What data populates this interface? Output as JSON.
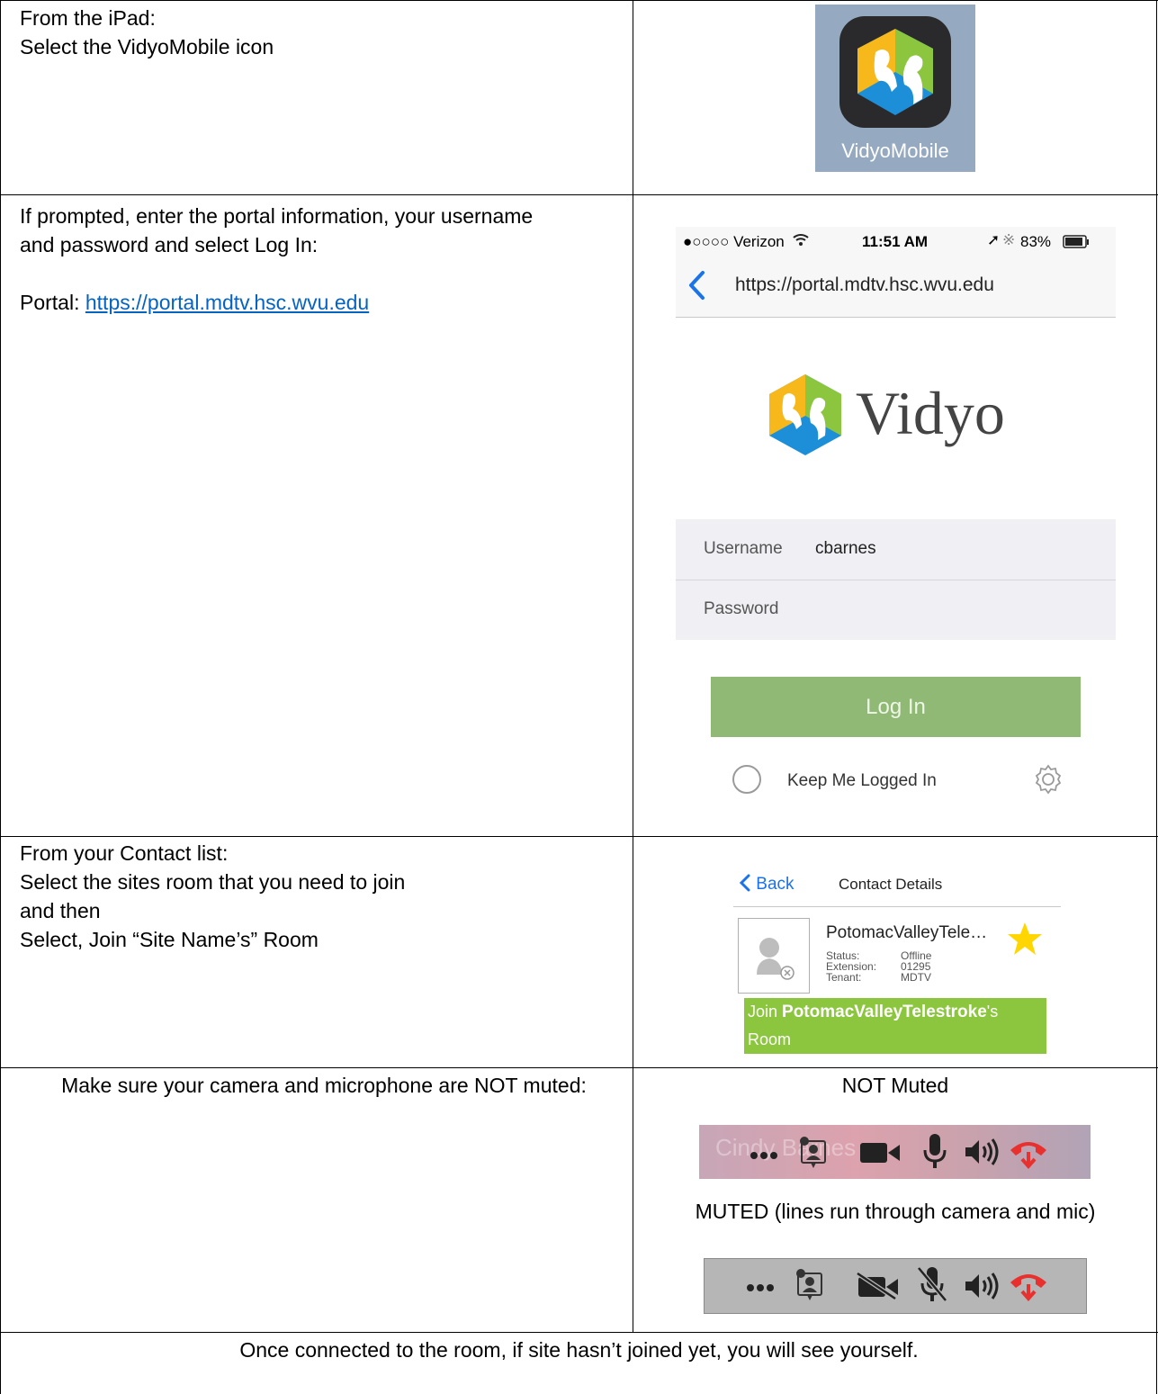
{
  "rows": {
    "r1": {
      "line1": "From the iPad:",
      "line2": "Select the VidyoMobile icon",
      "app_icon_label": "VidyoMobile"
    },
    "r2": {
      "text1": "If prompted, enter the portal information, your username and password and select Log In:",
      "portal_label": "Portal: ",
      "portal_link": "https://portal.mdtv.hsc.wvu.edu",
      "phone": {
        "carrier": "●○○○○ Verizon",
        "time": "11:51 AM",
        "battery": "83%",
        "url": "https://portal.mdtv.hsc.wvu.edu",
        "logo_text": "Vidyo",
        "username_label": "Username",
        "username_value": "cbarnes",
        "password_label": "Password",
        "login_button": "Log In",
        "keep_logged_in": "Keep Me Logged In"
      }
    },
    "r3": {
      "line1": "From your Contact list:",
      "line2": "Select the sites room that you need to join",
      "line3": "and then",
      "line4": "Select, Join “Site Name’s” Room",
      "contact": {
        "back": "Back",
        "title": "Contact Details",
        "name": "PotomacValleyTele…",
        "status_label": "Status:",
        "status_value": "Offline",
        "extension_label": "Extension:",
        "extension_value": "01295",
        "tenant_label": "Tenant:",
        "tenant_value": "MDTV",
        "join_prefix": "Join ",
        "join_room": "PotomacValleyTelestroke",
        "join_suffix": "'s",
        "join_line2": "Room"
      }
    },
    "r4": {
      "text": "Make sure your camera and microphone are NOT muted:",
      "not_muted": "NOT Muted",
      "ghost_name": "Cindy Barnes",
      "muted": "MUTED (lines run through camera and mic)"
    },
    "r5": {
      "text": "Once connected to the room, if site hasn’t joined yet, you will see yourself."
    }
  },
  "colors": {
    "link": "#0563c1",
    "login_green": "#8fb974",
    "join_green": "#8cc63f",
    "ios_blue": "#1a73e8",
    "hangup_red": "#e8312f"
  }
}
